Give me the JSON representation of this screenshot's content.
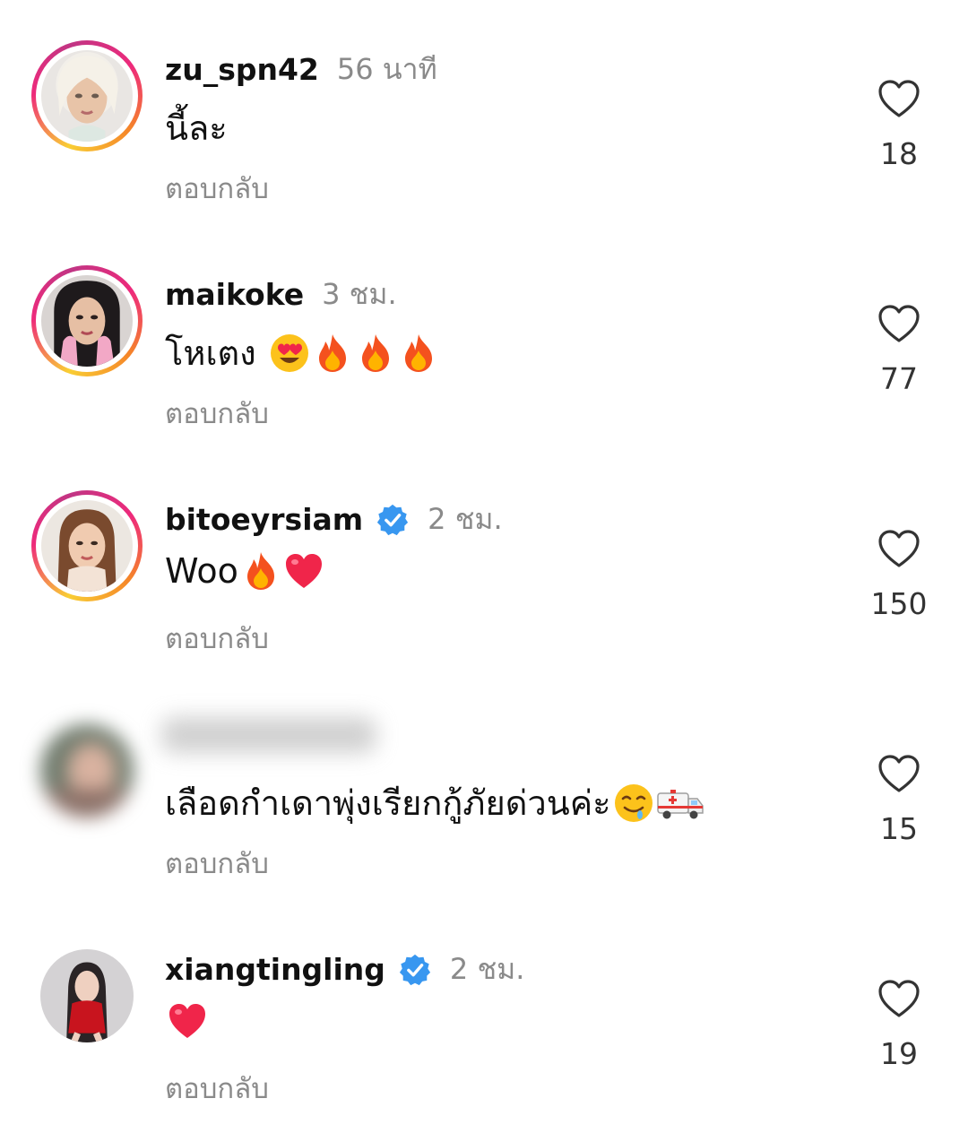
{
  "comments": [
    {
      "username": "zu_spn42",
      "verified": false,
      "time": "56 นาที",
      "text": "นี้ละ",
      "emojis": [],
      "reply_label": "ตอบกลับ",
      "likes": "18",
      "avatar_story_ring": true
    },
    {
      "username": "maikoke",
      "verified": false,
      "time": "3 ชม.",
      "text": "โหเตง",
      "emojis": [
        "heart-eyes",
        "fire",
        "fire",
        "fire"
      ],
      "reply_label": "ตอบกลับ",
      "likes": "77",
      "avatar_story_ring": true
    },
    {
      "username": "bitoeyrsiam",
      "verified": true,
      "time": "2 ชม.",
      "text": "Woo",
      "emojis": [
        "fire",
        "red-heart"
      ],
      "reply_label": "ตอบกลับ",
      "likes": "150",
      "avatar_story_ring": true
    },
    {
      "username": "",
      "verified": false,
      "time": "",
      "text": "เลือดกำเดาพุ่งเรียกกู้ภัยด่วนค่ะ",
      "emojis": [
        "drooling-face",
        "ambulance"
      ],
      "reply_label": "ตอบกลับ",
      "likes": "15",
      "avatar_story_ring": false,
      "blurred_identity": true
    },
    {
      "username": "xiangtingling",
      "verified": true,
      "time": "2 ชม.",
      "text": "",
      "emojis": [
        "red-heart"
      ],
      "reply_label": "ตอบกลับ",
      "likes": "19",
      "avatar_story_ring": false
    }
  ],
  "colors": {
    "verified": "#3897f0",
    "muted_text": "#8a8a8a",
    "story_ring_start": "#f9ce34",
    "story_ring_end": "#ee2a7b"
  }
}
